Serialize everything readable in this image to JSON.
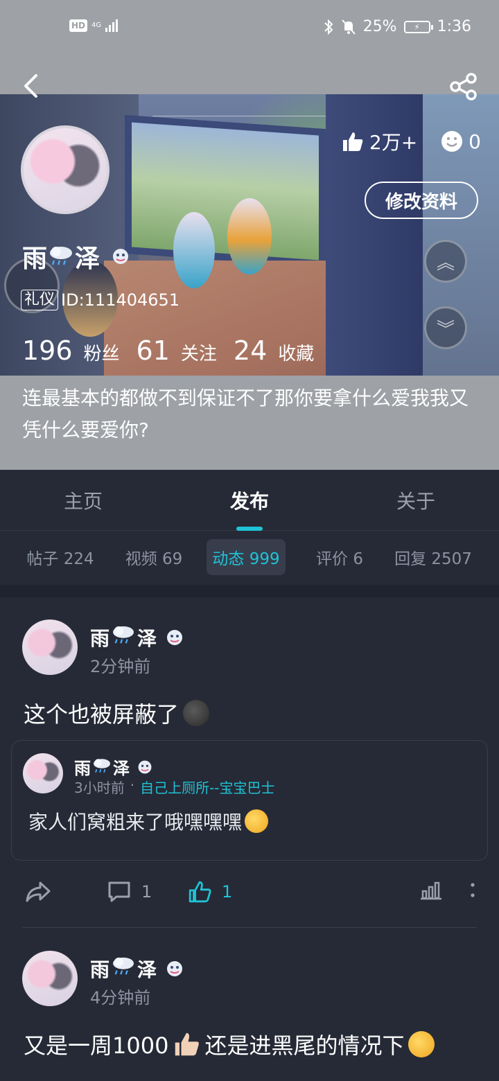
{
  "status_bar": {
    "hd": "HD",
    "network": "4G",
    "battery_percent": "25%",
    "time": "1:36"
  },
  "nav": {
    "back_icon": "chevron-left-icon",
    "share_icon": "share-icon"
  },
  "profile": {
    "likes": "2万+",
    "smiles": "0",
    "edit_button": "修改资料",
    "username_part1": "雨",
    "username_part2": "泽",
    "tag": "礼仪",
    "id_text": "ID:111404651",
    "followers_count": "196",
    "followers_label": "粉丝",
    "following_count": "61",
    "following_label": "关注",
    "favorites_count": "24",
    "favorites_label": "收藏",
    "bio": "连最基本的都做不到保证不了那你要拿什么爱我我又凭什么要爱你?"
  },
  "main_tabs": [
    "主页",
    "发布",
    "关于"
  ],
  "main_tab_active": "发布",
  "sub_tabs": [
    {
      "label": "帖子 224"
    },
    {
      "label": "视频 69"
    },
    {
      "label": "动态 999"
    },
    {
      "label": "评价 6"
    },
    {
      "label": "回复 2507"
    }
  ],
  "posts": [
    {
      "name_part1": "雨",
      "name_part2": "泽",
      "time": "2分钟前",
      "text": "这个也被屏蔽了",
      "quote": {
        "name_part1": "雨",
        "name_part2": "泽",
        "time": "3小时前",
        "separator": "·",
        "source": "自己上厕所--宝宝巴士",
        "text": "家人们窝粗来了哦嘿嘿嘿"
      },
      "comments": "1",
      "likes": "1"
    },
    {
      "name_part1": "雨",
      "name_part2": "泽",
      "time": "4分钟前",
      "text": "又是一周1000",
      "text_suffix": "还是进黑尾的情况下"
    }
  ],
  "colors": {
    "accent": "#1fc3d6",
    "background": "#262a36",
    "header_gray": "#9ea1a6"
  }
}
